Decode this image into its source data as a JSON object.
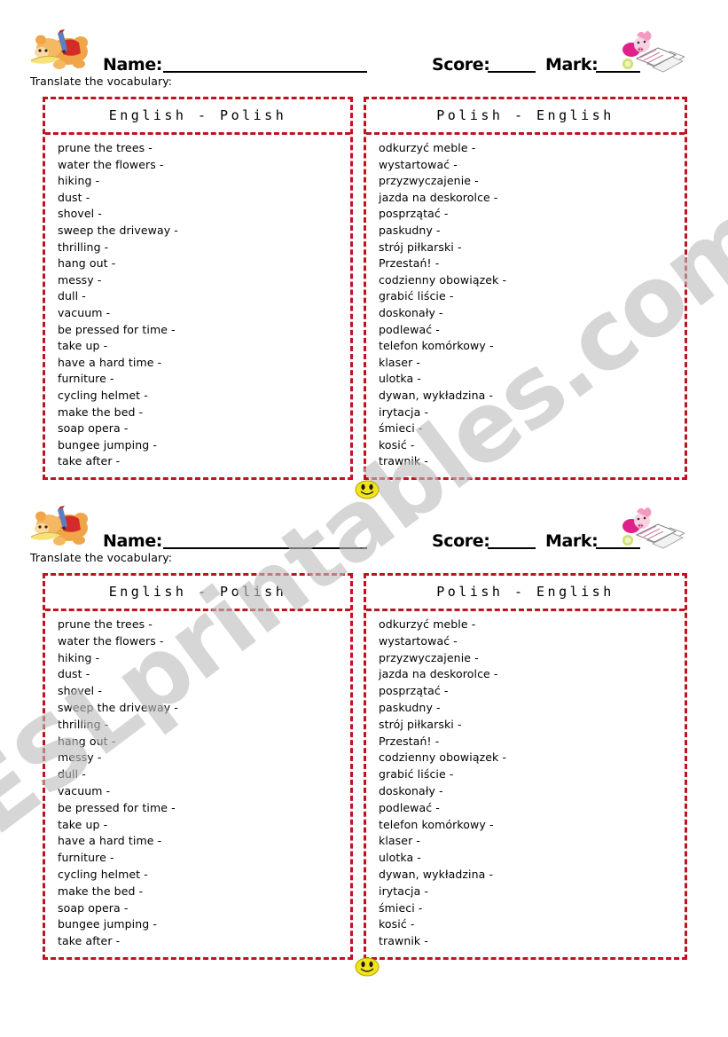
{
  "watermark": {
    "text": "ESLprintables.com"
  },
  "header": {
    "name_label": "Name:",
    "score_label": "Score:",
    "mark_label": "Mark:",
    "instruction": "Translate the vocabulary:",
    "bear_icon": "bear-writing-icon",
    "piglet_icon": "piglet-studying-icon"
  },
  "tables": {
    "left": {
      "title": "English - Polish",
      "items": [
        "prune the trees -",
        "water the flowers -",
        "hiking -",
        "dust -",
        "shovel -",
        "sweep the driveway -",
        "thrilling -",
        "hang out -",
        "messy -",
        "dull -",
        "vacuum -",
        "be pressed for time -",
        "take up -",
        "have a hard time -",
        "furniture -",
        "cycling helmet -",
        "make the bed -",
        "soap opera -",
        "bungee jumping -",
        "take after -"
      ]
    },
    "right": {
      "title": "Polish - English",
      "items": [
        "odkurzyć meble -",
        "wystartować -",
        "przyzwyczajenie -",
        "jazda na deskorolce -",
        "posprzątać -",
        "paskudny -",
        "strój piłkarski -",
        "Przestań! -",
        "codzienny obowiązek -",
        "grabić liście -",
        "doskonały -",
        "podlewać -",
        "telefon komórkowy -",
        "klaser -",
        "ulotka -",
        "dywan, wykładzina -",
        "irytacja -",
        "śmieci -",
        "kosić -",
        "trawnik -"
      ]
    }
  },
  "decorations": {
    "smiley_icon": "smiley-face-icon"
  },
  "colors": {
    "border_red": "#c1121f",
    "watermark_gray": "#bdbdbd",
    "smiley_yellow": "#f2e41c"
  }
}
